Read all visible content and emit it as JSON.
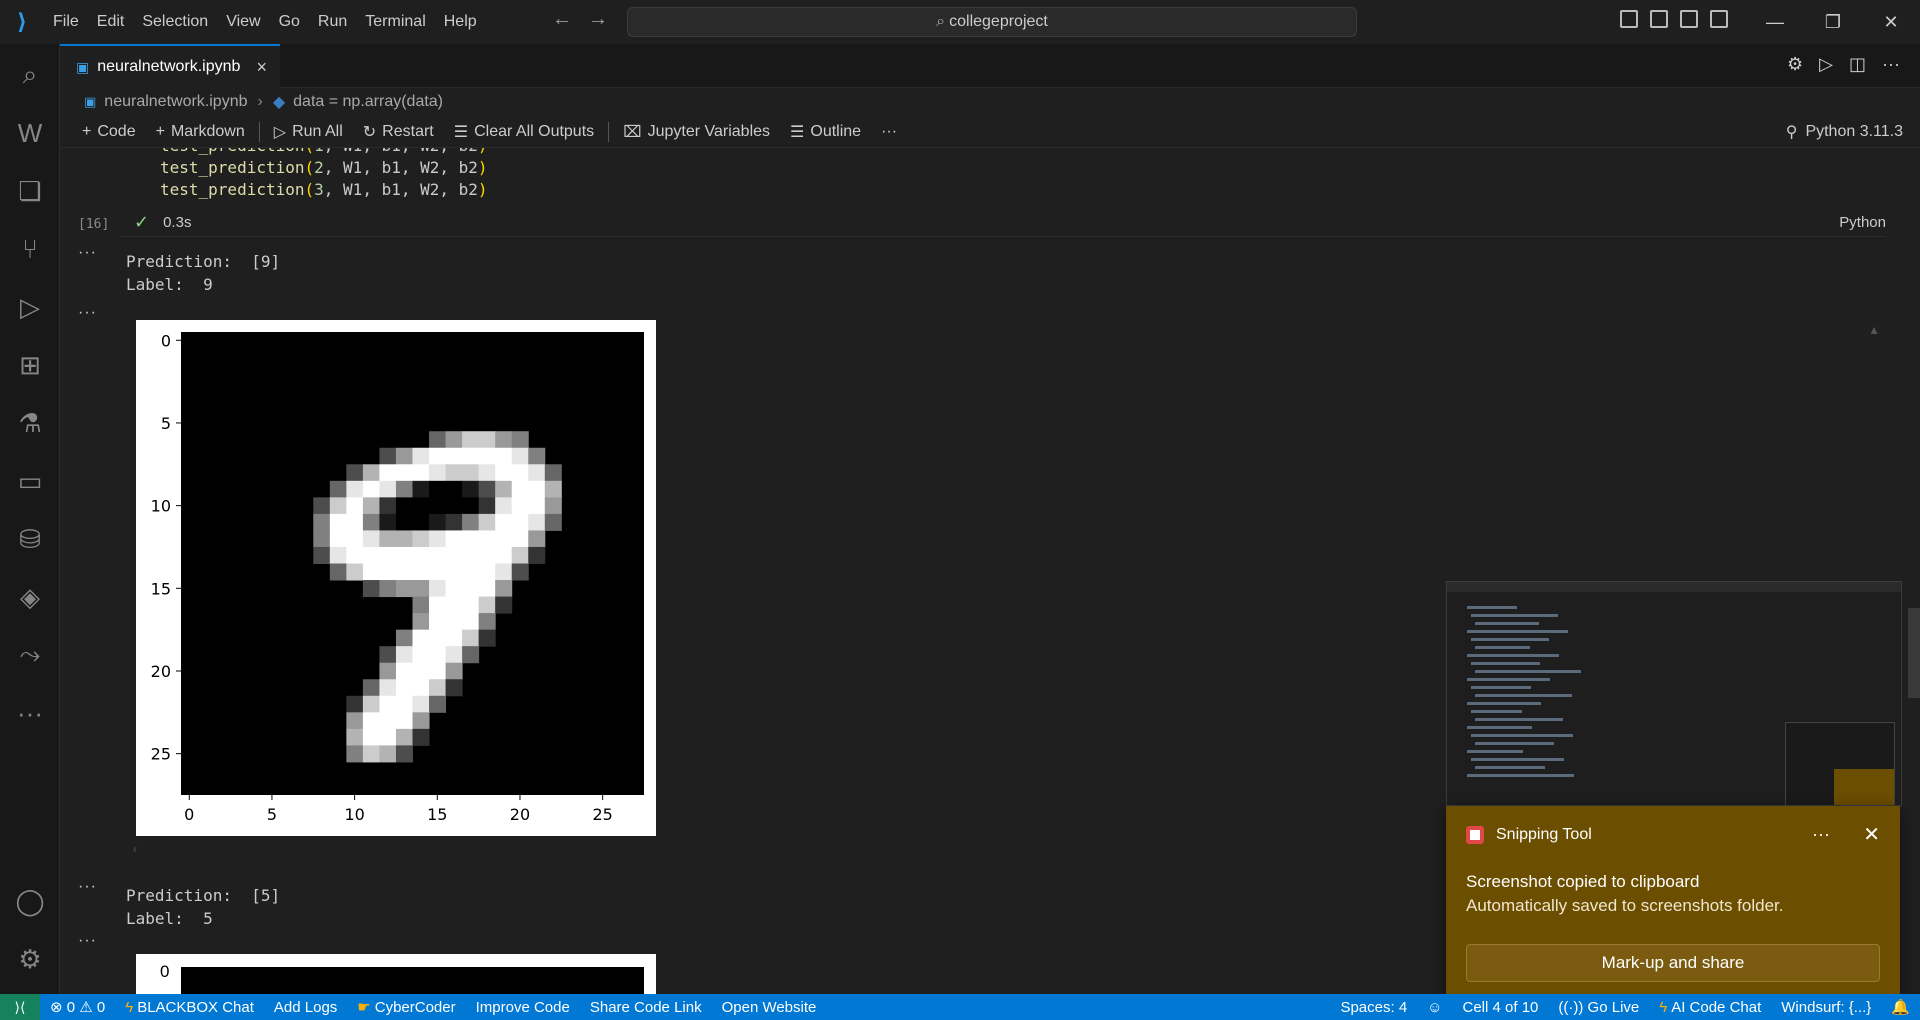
{
  "menu": [
    "File",
    "Edit",
    "Selection",
    "View",
    "Go",
    "Run",
    "Terminal",
    "Help"
  ],
  "search": {
    "text": "collegeproject"
  },
  "tab": {
    "label": "neuralnetwork.ipynb",
    "close": "×"
  },
  "breadcrumb": {
    "file": "neuralnetwork.ipynb",
    "symbol": "data = np.array(data)"
  },
  "toolbar": {
    "code": "Code",
    "markdown": "Markdown",
    "run_all": "Run All",
    "restart": "Restart",
    "clear_outputs": "Clear All Outputs",
    "variables": "Jupyter Variables",
    "outline": "Outline",
    "more": "···",
    "kernel": "Python 3.11.3"
  },
  "cell": {
    "lines": [
      {
        "fn": "test_prediction",
        "arg": "1"
      },
      {
        "fn": "test_prediction",
        "arg": "2"
      },
      {
        "fn": "test_prediction",
        "arg": "3"
      }
    ],
    "args_rest": ", W1, b1, W2, b2",
    "exec_count": "[16]",
    "duration": "0.3s",
    "language": "Python"
  },
  "outputs": [
    {
      "prediction": "Prediction:  [9]",
      "label": "Label:  9"
    },
    {
      "prediction": "Prediction:  [5]",
      "label": "Label:  5"
    }
  ],
  "chart_data": {
    "type": "heatmap",
    "colormap": "gray",
    "x_ticks": [
      "0",
      "5",
      "10",
      "15",
      "20",
      "25"
    ],
    "y_ticks": [
      "0",
      "5",
      "10",
      "15",
      "20",
      "25"
    ],
    "grid_size": [
      28,
      28
    ],
    "rows": [
      {
        "r": 6,
        "cells": [
          [
            15,
            0.4
          ],
          [
            16,
            0.6
          ],
          [
            17,
            0.8
          ],
          [
            18,
            0.8
          ],
          [
            19,
            0.6
          ],
          [
            20,
            0.5
          ]
        ]
      },
      {
        "r": 7,
        "cells": [
          [
            12,
            0.3
          ],
          [
            13,
            0.6
          ],
          [
            14,
            0.9
          ],
          [
            15,
            1
          ],
          [
            16,
            1
          ],
          [
            17,
            1
          ],
          [
            18,
            1
          ],
          [
            19,
            1
          ],
          [
            20,
            0.9
          ],
          [
            21,
            0.5
          ]
        ]
      },
      {
        "r": 8,
        "cells": [
          [
            10,
            0.3
          ],
          [
            11,
            0.7
          ],
          [
            12,
            1
          ],
          [
            13,
            1
          ],
          [
            14,
            1
          ],
          [
            15,
            0.9
          ],
          [
            16,
            0.8
          ],
          [
            17,
            0.8
          ],
          [
            18,
            0.9
          ],
          [
            19,
            1
          ],
          [
            20,
            1
          ],
          [
            21,
            0.9
          ],
          [
            22,
            0.4
          ]
        ]
      },
      {
        "r": 9,
        "cells": [
          [
            9,
            0.4
          ],
          [
            10,
            0.9
          ],
          [
            11,
            1
          ],
          [
            12,
            0.9
          ],
          [
            13,
            0.5
          ],
          [
            14,
            0.1
          ],
          [
            15,
            0
          ],
          [
            16,
            0
          ],
          [
            17,
            0.1
          ],
          [
            18,
            0.3
          ],
          [
            19,
            0.7
          ],
          [
            20,
            1
          ],
          [
            21,
            1
          ],
          [
            22,
            0.7
          ]
        ]
      },
      {
        "r": 10,
        "cells": [
          [
            8,
            0.3
          ],
          [
            9,
            0.8
          ],
          [
            10,
            1
          ],
          [
            11,
            0.7
          ],
          [
            12,
            0.2
          ],
          [
            13,
            0
          ],
          [
            14,
            0
          ],
          [
            15,
            0
          ],
          [
            16,
            0
          ],
          [
            17,
            0
          ],
          [
            18,
            0.2
          ],
          [
            19,
            0.9
          ],
          [
            20,
            1
          ],
          [
            21,
            1
          ],
          [
            22,
            0.6
          ]
        ]
      },
      {
        "r": 11,
        "cells": [
          [
            8,
            0.5
          ],
          [
            9,
            1
          ],
          [
            10,
            1
          ],
          [
            11,
            0.5
          ],
          [
            12,
            0.1
          ],
          [
            13,
            0
          ],
          [
            14,
            0
          ],
          [
            15,
            0.1
          ],
          [
            16,
            0.2
          ],
          [
            17,
            0.5
          ],
          [
            18,
            0.8
          ],
          [
            19,
            1
          ],
          [
            20,
            1
          ],
          [
            21,
            0.9
          ],
          [
            22,
            0.4
          ]
        ]
      },
      {
        "r": 12,
        "cells": [
          [
            8,
            0.5
          ],
          [
            9,
            1
          ],
          [
            10,
            1
          ],
          [
            11,
            0.9
          ],
          [
            12,
            0.7
          ],
          [
            13,
            0.7
          ],
          [
            14,
            0.8
          ],
          [
            15,
            0.9
          ],
          [
            16,
            1
          ],
          [
            17,
            1
          ],
          [
            18,
            1
          ],
          [
            19,
            1
          ],
          [
            20,
            1
          ],
          [
            21,
            0.6
          ]
        ]
      },
      {
        "r": 13,
        "cells": [
          [
            8,
            0.3
          ],
          [
            9,
            0.9
          ],
          [
            10,
            1
          ],
          [
            11,
            1
          ],
          [
            12,
            1
          ],
          [
            13,
            1
          ],
          [
            14,
            1
          ],
          [
            15,
            1
          ],
          [
            16,
            1
          ],
          [
            17,
            1
          ],
          [
            18,
            1
          ],
          [
            19,
            1
          ],
          [
            20,
            0.8
          ],
          [
            21,
            0.2
          ]
        ]
      },
      {
        "r": 14,
        "cells": [
          [
            9,
            0.4
          ],
          [
            10,
            0.8
          ],
          [
            11,
            1
          ],
          [
            12,
            1
          ],
          [
            13,
            1
          ],
          [
            14,
            1
          ],
          [
            15,
            1
          ],
          [
            16,
            1
          ],
          [
            17,
            1
          ],
          [
            18,
            1
          ],
          [
            19,
            0.9
          ],
          [
            20,
            0.3
          ]
        ]
      },
      {
        "r": 15,
        "cells": [
          [
            11,
            0.3
          ],
          [
            12,
            0.5
          ],
          [
            13,
            0.6
          ],
          [
            14,
            0.6
          ],
          [
            15,
            0.9
          ],
          [
            16,
            1
          ],
          [
            17,
            1
          ],
          [
            18,
            1
          ],
          [
            19,
            0.6
          ]
        ]
      },
      {
        "r": 16,
        "cells": [
          [
            14,
            0.5
          ],
          [
            15,
            1
          ],
          [
            16,
            1
          ],
          [
            17,
            1
          ],
          [
            18,
            0.8
          ],
          [
            19,
            0.2
          ]
        ]
      },
      {
        "r": 17,
        "cells": [
          [
            14,
            0.6
          ],
          [
            15,
            1
          ],
          [
            16,
            1
          ],
          [
            17,
            1
          ],
          [
            18,
            0.5
          ]
        ]
      },
      {
        "r": 18,
        "cells": [
          [
            13,
            0.5
          ],
          [
            14,
            1
          ],
          [
            15,
            1
          ],
          [
            16,
            1
          ],
          [
            17,
            0.8
          ],
          [
            18,
            0.2
          ]
        ]
      },
      {
        "r": 19,
        "cells": [
          [
            12,
            0.3
          ],
          [
            13,
            0.9
          ],
          [
            14,
            1
          ],
          [
            15,
            1
          ],
          [
            16,
            0.9
          ],
          [
            17,
            0.4
          ]
        ]
      },
      {
        "r": 20,
        "cells": [
          [
            12,
            0.6
          ],
          [
            13,
            1
          ],
          [
            14,
            1
          ],
          [
            15,
            1
          ],
          [
            16,
            0.6
          ]
        ]
      },
      {
        "r": 21,
        "cells": [
          [
            11,
            0.4
          ],
          [
            12,
            0.9
          ],
          [
            13,
            1
          ],
          [
            14,
            1
          ],
          [
            15,
            0.8
          ],
          [
            16,
            0.2
          ]
        ]
      },
      {
        "r": 22,
        "cells": [
          [
            10,
            0.2
          ],
          [
            11,
            0.8
          ],
          [
            12,
            1
          ],
          [
            13,
            1
          ],
          [
            14,
            0.9
          ],
          [
            15,
            0.4
          ]
        ]
      },
      {
        "r": 23,
        "cells": [
          [
            10,
            0.6
          ],
          [
            11,
            1
          ],
          [
            12,
            1
          ],
          [
            13,
            1
          ],
          [
            14,
            0.6
          ]
        ]
      },
      {
        "r": 24,
        "cells": [
          [
            10,
            0.7
          ],
          [
            11,
            1
          ],
          [
            12,
            1
          ],
          [
            13,
            0.7
          ],
          [
            14,
            0.2
          ]
        ]
      },
      {
        "r": 25,
        "cells": [
          [
            10,
            0.5
          ],
          [
            11,
            0.8
          ],
          [
            12,
            0.7
          ],
          [
            13,
            0.3
          ]
        ]
      }
    ]
  },
  "second_plot": {
    "first_tick": "0"
  },
  "toast": {
    "app": "Snipping Tool",
    "more": "···",
    "close": "✕",
    "title": "Screenshot copied to clipboard",
    "body": "Automatically saved to screenshots folder.",
    "button": "Mark-up and share"
  },
  "status": {
    "errors": "0",
    "warnings": "0",
    "left_items": [
      "BLACKBOX Chat",
      "Add Logs",
      "CyberCoder",
      "Improve Code",
      "Share Code Link",
      "Open Website"
    ],
    "spaces": "Spaces: 4",
    "cell": "Cell 4 of 10",
    "go_live": "Go Live",
    "ai_chat": "AI Code Chat",
    "windsurf": "Windsurf: {...}"
  },
  "colors": {
    "accent": "#0078d4",
    "toast": "#6b4e00",
    "check": "#89d185"
  }
}
